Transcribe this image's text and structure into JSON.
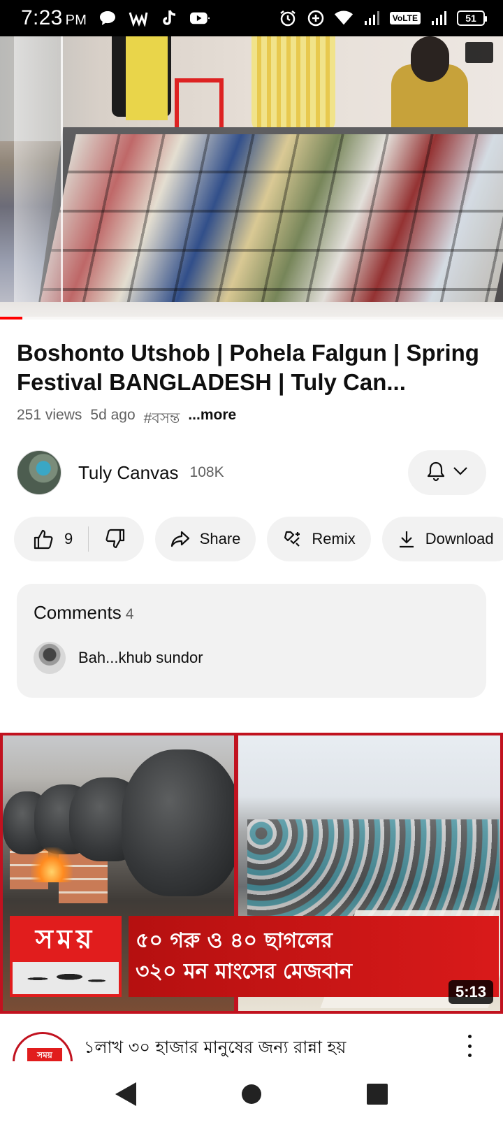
{
  "status_bar": {
    "time": "7:23",
    "ampm": "PM",
    "volte": "VoLTE",
    "battery": "51"
  },
  "player": {
    "progress": 0.045
  },
  "video": {
    "title": "Boshonto Utshob | Pohela Falgun | Spring Festival BANGLADESH | Tuly Can...",
    "views": "251 views",
    "age": "5d ago",
    "hashtag": "#বসন্ত",
    "more": "...more"
  },
  "channel": {
    "name": "Tuly Canvas",
    "subscribers": "108K"
  },
  "actions": {
    "like_count": "9",
    "share": "Share",
    "remix": "Remix",
    "download": "Download"
  },
  "comments": {
    "heading": "Comments",
    "count": "4",
    "top_comment": "Bah...khub sundor"
  },
  "next_video": {
    "logo_text": "সময়",
    "headline_line1": "৫০ গরু ও ৪০ ছাগলের",
    "headline_line2": "৩২০ মন মাংসের মেজবান",
    "duration": "5:13",
    "title": "১লাখ ৩০ হাজার মানুষের জন্য রান্না হয়",
    "channel_logo": "সময়"
  },
  "colors": {
    "accent_red": "#ff0000",
    "pill_bg": "#f2f2f2",
    "text_secondary": "#606060"
  }
}
